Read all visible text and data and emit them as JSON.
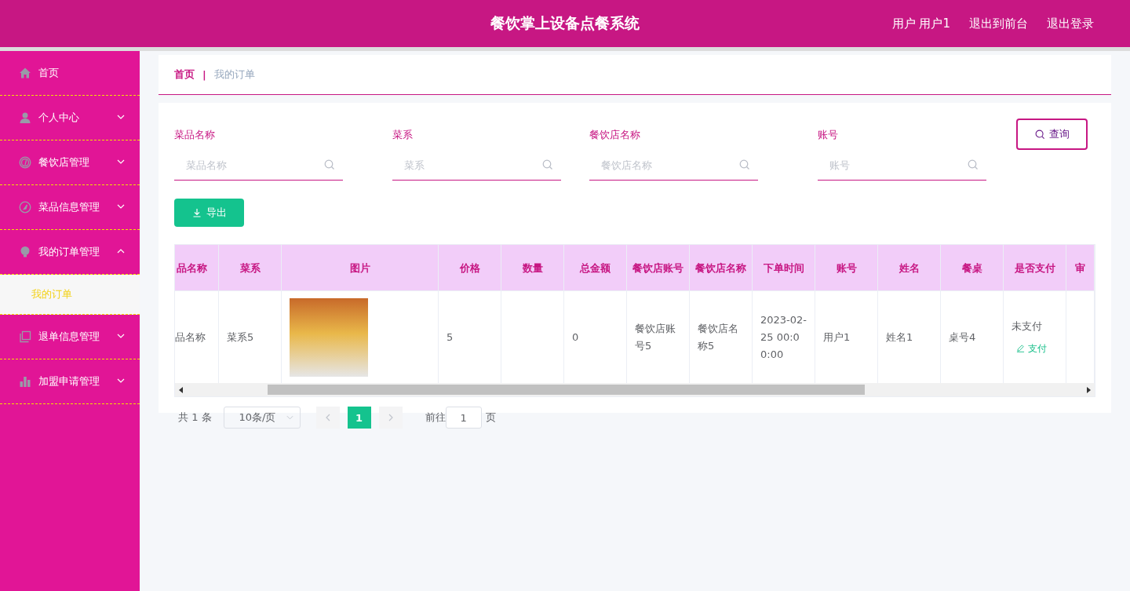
{
  "header": {
    "title": "餐饮掌上设备点餐系统",
    "links": [
      "用户 用户1",
      "退出到前台",
      "退出登录"
    ]
  },
  "sidebar": {
    "items": [
      {
        "label": "首页"
      },
      {
        "label": "个人中心",
        "expanded": false
      },
      {
        "label": "餐饮店管理",
        "expanded": false
      },
      {
        "label": "菜品信息管理",
        "expanded": false
      },
      {
        "label": "我的订单管理",
        "expanded": true,
        "children": [
          {
            "label": "我的订单",
            "selected": true
          }
        ]
      },
      {
        "label": "退单信息管理",
        "expanded": false
      },
      {
        "label": "加盟申请管理",
        "expanded": false
      }
    ]
  },
  "breadcrumb": {
    "items": [
      "首页",
      "我的订单"
    ],
    "separator": "|"
  },
  "filters": [
    {
      "label": "菜品名称",
      "placeholder": "菜品名称"
    },
    {
      "label": "菜系",
      "placeholder": "菜系"
    },
    {
      "label": "餐饮店名称",
      "placeholder": "餐饮店名称"
    },
    {
      "label": "账号",
      "placeholder": "账号"
    }
  ],
  "search_button": "查询",
  "export_button": "导出",
  "table": {
    "columns": [
      "品名称",
      "菜系",
      "图片",
      "价格",
      "数量",
      "总金额",
      "餐饮店账号",
      "餐饮店名称",
      "下单时间",
      "账号",
      "姓名",
      "餐桌",
      "是否支付",
      "审"
    ],
    "rows": [
      {
        "cells": [
          {
            "kind": "text",
            "text": "品名称"
          },
          {
            "kind": "text",
            "text": "菜系5"
          },
          {
            "kind": "image"
          },
          {
            "kind": "text",
            "text": "5"
          },
          {
            "kind": "text",
            "text": ""
          },
          {
            "kind": "text",
            "text": "0"
          },
          {
            "kind": "text",
            "text": "餐饮店账号5"
          },
          {
            "kind": "text",
            "text": "餐饮店名称5"
          },
          {
            "kind": "text",
            "text": "2023-02-25 00:00:00"
          },
          {
            "kind": "text",
            "text": "用户1"
          },
          {
            "kind": "text",
            "text": "姓名1"
          },
          {
            "kind": "text",
            "text": "桌号4"
          },
          {
            "kind": "pay",
            "text": "未支付",
            "action": "支付"
          },
          {
            "kind": "text",
            "text": ""
          }
        ]
      }
    ]
  },
  "pagination": {
    "total": "共 1 条",
    "page_size": "10条/页",
    "pages": [
      {
        "label": "1",
        "selected": true
      }
    ],
    "goto_label": "前往",
    "goto_value": "1",
    "goto_suffix": "页"
  }
}
